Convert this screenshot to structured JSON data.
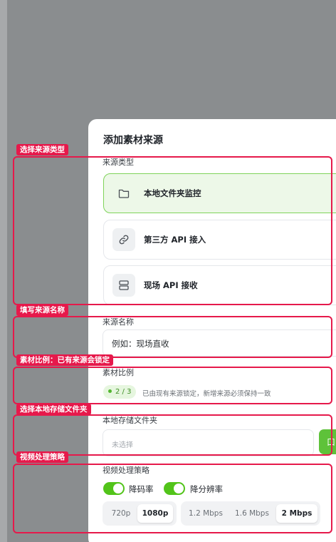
{
  "modal": {
    "title": "添加素材来源",
    "source_type": {
      "label": "来源类型",
      "options": [
        {
          "label": "本地文件夹监控",
          "icon": "folder-icon",
          "selected": true
        },
        {
          "label": "第三方 API 接入",
          "icon": "link-icon",
          "selected": false
        },
        {
          "label": "现场 API 接收",
          "icon": "server-icon",
          "selected": false
        }
      ]
    },
    "source_name": {
      "label": "来源名称",
      "value": "例如：现场直收"
    },
    "aspect_ratio": {
      "label": "素材比例",
      "badge": "2 / 3",
      "hint": "已由现有来源锁定，新增来源必须保持一致"
    },
    "local_folder": {
      "label": "本地存储文件夹",
      "placeholder": "未选择",
      "button_glyph": "口"
    },
    "video_strategy": {
      "label": "视频处理策略",
      "toggles": [
        {
          "label": "降码率",
          "on": true
        },
        {
          "label": "降分辨率",
          "on": true
        }
      ],
      "resolution": {
        "options": [
          "720p",
          "1080p"
        ],
        "selected": "1080p"
      },
      "bitrate": {
        "options": [
          "1.2 Mbps",
          "1.6 Mbps",
          "2 Mbps"
        ],
        "selected": "2 Mbps"
      }
    }
  },
  "annotations": [
    {
      "label": "选择来源类型"
    },
    {
      "label": "填写来源名称"
    },
    {
      "label": "素材比例：已有来源会锁定"
    },
    {
      "label": "选择本地存储文件夹"
    },
    {
      "label": "视频处理策略"
    }
  ],
  "colors": {
    "accent": "#52c41a",
    "annotation": "#e6194b",
    "selected_bg": "#edf8e8",
    "backdrop": "#8a8d8f"
  }
}
